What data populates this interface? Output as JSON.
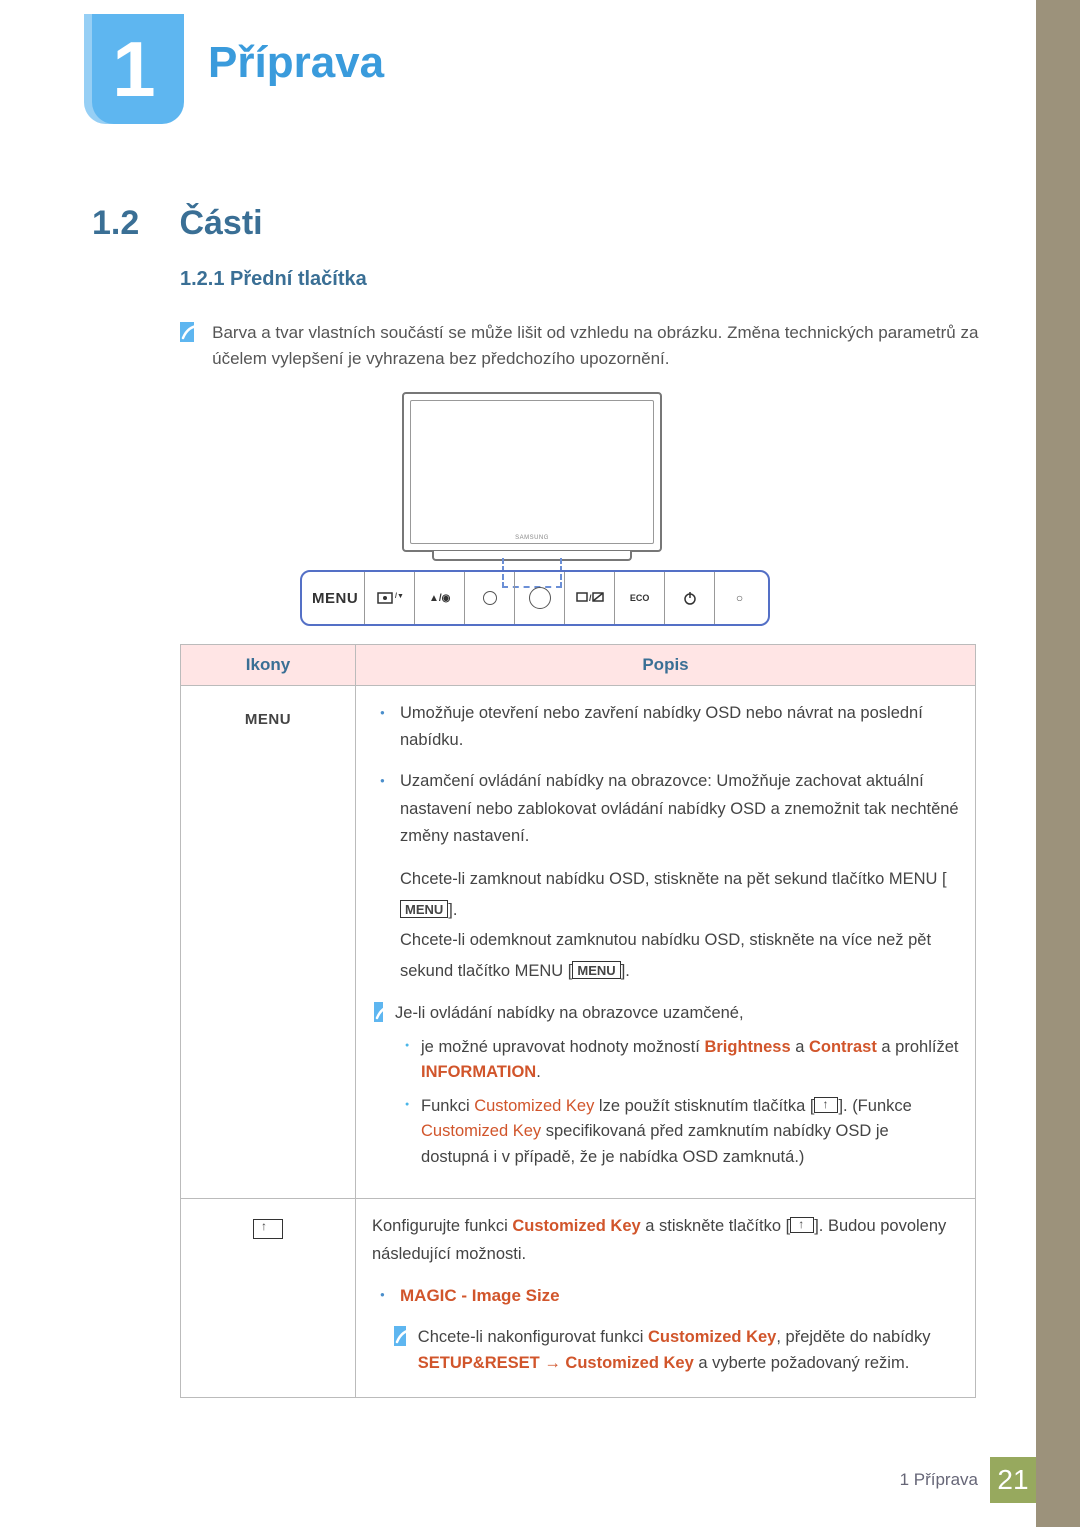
{
  "chapter": {
    "number": "1",
    "title": "Příprava"
  },
  "section": {
    "number": "1.2",
    "title": "Části"
  },
  "subsection": {
    "number": "1.2.1",
    "title": "Přední tlačítka"
  },
  "intro_note": "Barva a tvar vlastních součástí se může lišit od vzhledu na obrázku. Změna technických parametrů za účelem vylepšení je vyhrazena bez předchozího upozornění.",
  "diagram": {
    "brand": "SAMSUNG",
    "panel": [
      "MENU",
      "brightness/volume",
      "up/adjust",
      "circle-small",
      "circle-large",
      "source",
      "ECO",
      "power",
      "led"
    ]
  },
  "table": {
    "headers": {
      "icons": "Ikony",
      "desc": "Popis"
    },
    "rows": [
      {
        "icon_label": "MENU",
        "bullet1": "Umožňuje otevření nebo zavření nabídky OSD nebo návrat na poslední nabídku.",
        "bullet2": "Uzamčení ovládání nabídky na obrazovce: Umožňuje zachovat aktuální nastavení nebo zablokovat ovládání nabídky OSD a znemožnit tak nechtěné změny nastavení.",
        "lock_line_pre": "Chcete-li zamknout nabídku OSD, stiskněte na pět sekund tlačítko MENU [",
        "lock_line_post": "].",
        "unlock_line_pre": "Chcete-li odemknout zamknutou nabídku OSD, stiskněte na více než pět sekund tlačítko MENU [",
        "unlock_line_post": "].",
        "inner_note_lead": "Je-li ovládání nabídky na obrazovce uzamčené,",
        "inner_sub1_pre": "je možné upravovat hodnoty možností ",
        "brightness": "Brightness",
        "and": " a ",
        "contrast": "Contrast",
        "inner_sub1_post": " a prohlížet ",
        "information": "INFORMATION",
        "dot": ".",
        "inner_sub2_pre": "Funkci ",
        "customized_key": "Customized Key",
        "inner_sub2_mid1": " lze použít stisknutím tlačítka [",
        "inner_sub2_mid2": "]. (Funkce ",
        "inner_sub2_post": " specifikovaná před zamknutím nabídky OSD je dostupná i v případě, že je nabídka OSD zamknutá.)"
      },
      {
        "line1_pre": "Konfigurujte funkci ",
        "line1_mid": " a stiskněte tlačítko [",
        "line1_post": "]. Budou povoleny následující možnosti.",
        "option": "MAGIC - Image Size",
        "note_pre": "Chcete-li nakonfigurovat funkci ",
        "note_mid": ", přejděte do nabídky ",
        "setup": "SETUP&RESET",
        "arrow": " → ",
        "note_end": " a vyberte požadovaný režim."
      }
    ]
  },
  "footer": {
    "label": "1 Příprava",
    "page": "21"
  },
  "ui_labels": {
    "menu_box": "MENU"
  }
}
